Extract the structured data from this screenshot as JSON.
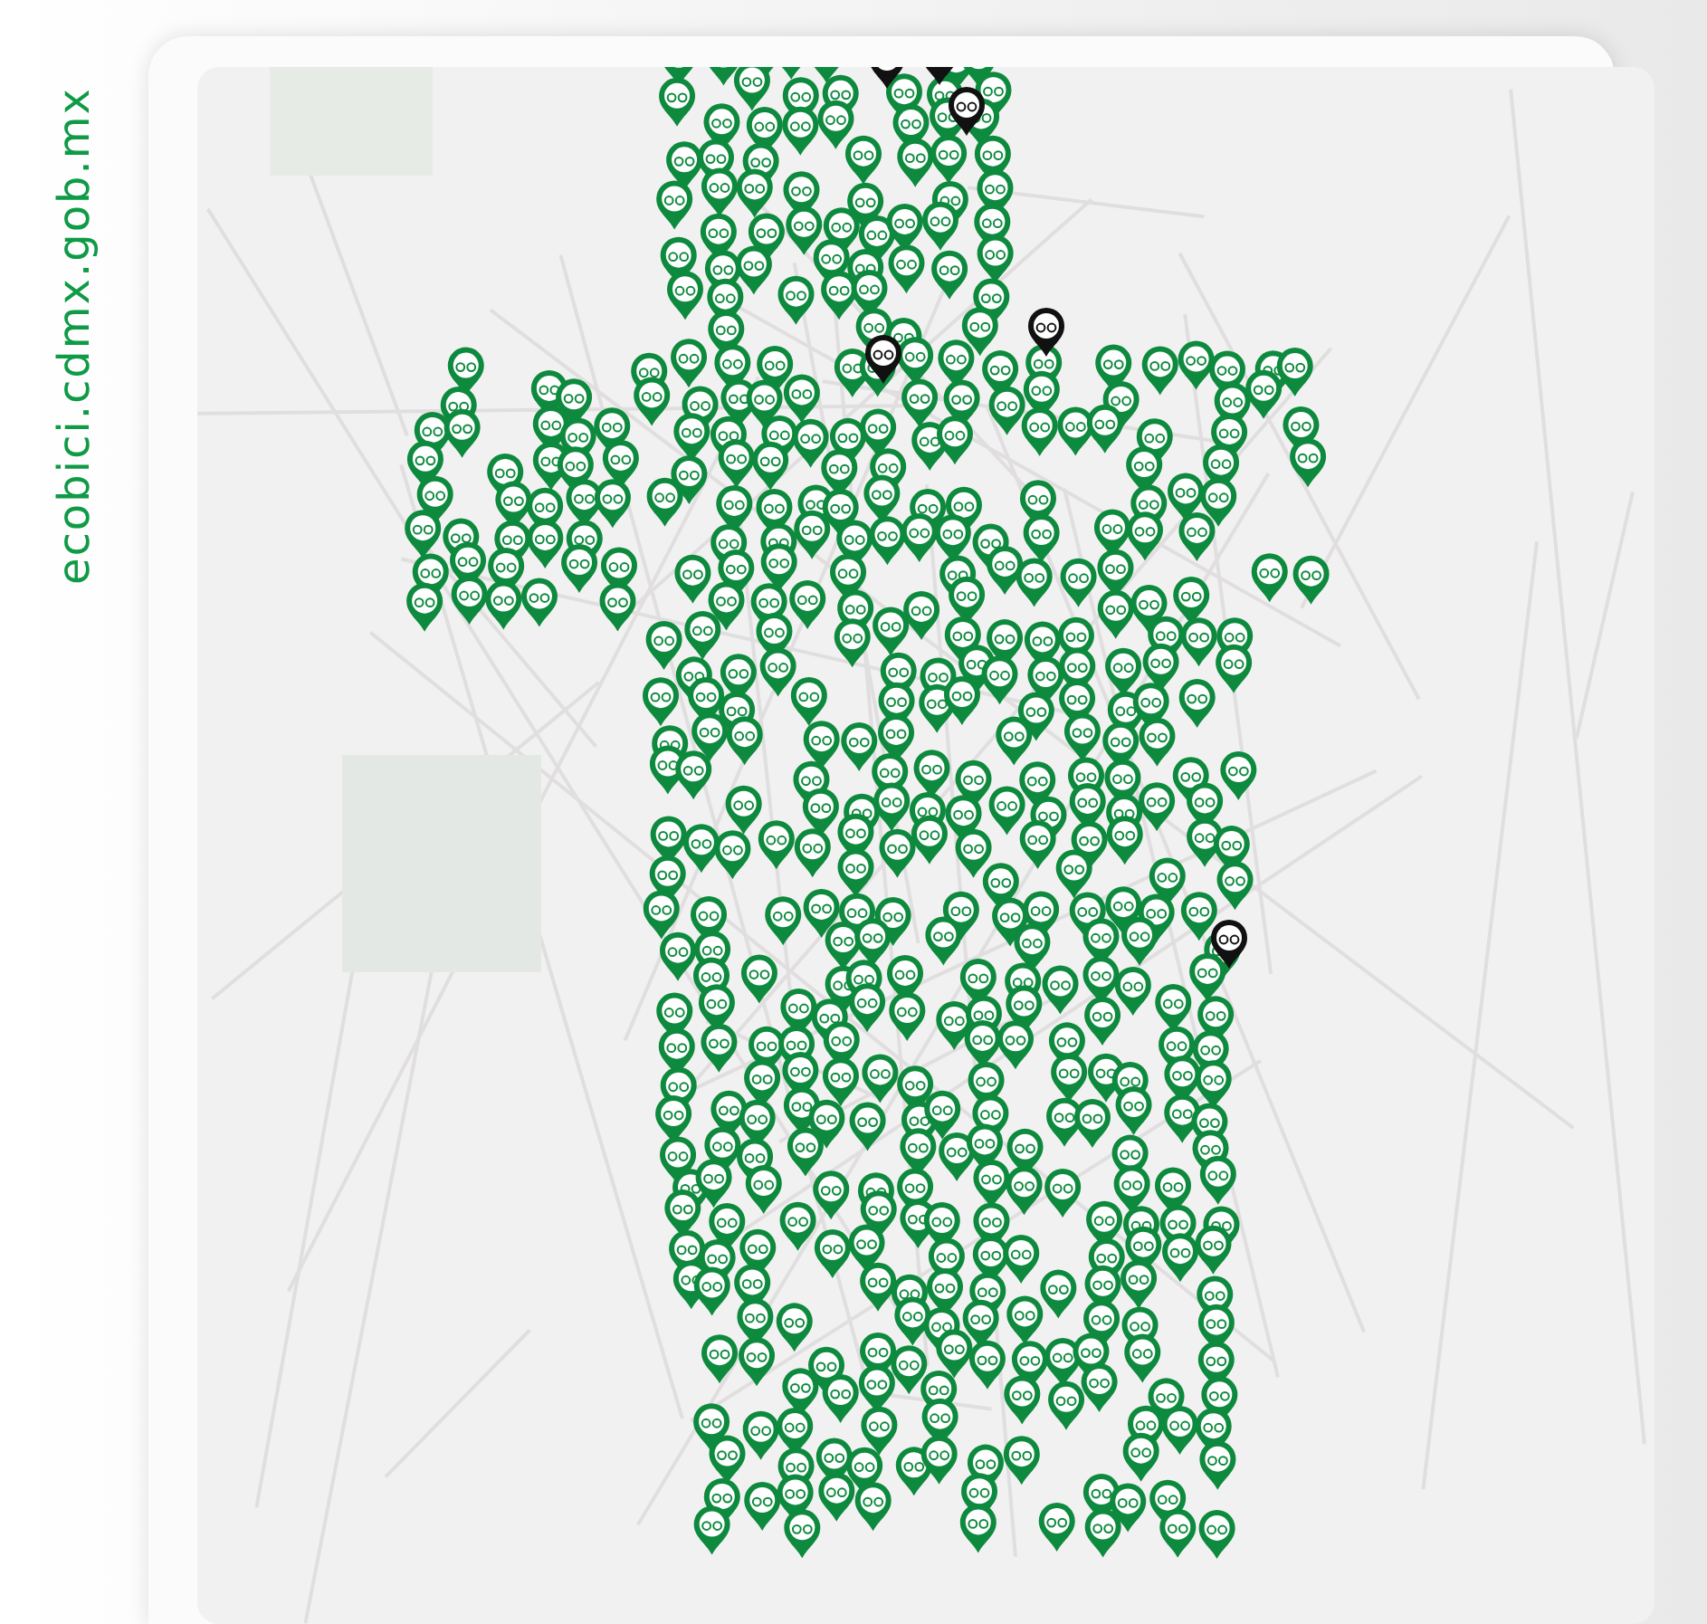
{
  "site_label": "ecobici.cdmx.gob.mx"
}
